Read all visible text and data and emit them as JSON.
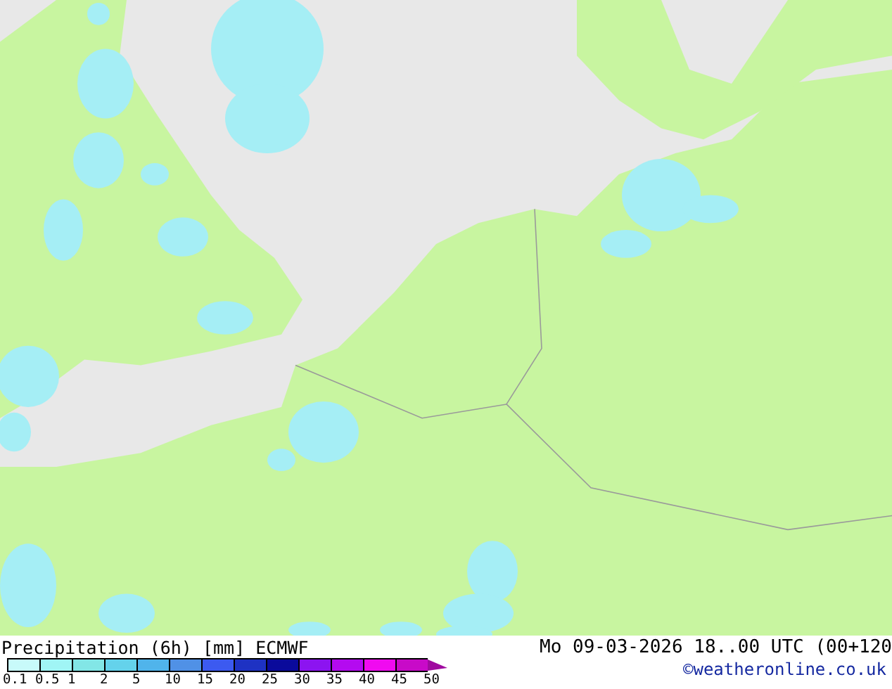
{
  "map": {
    "title": "Precipitation (6h) [mm] ECMWF",
    "valid_time": "Mo 09-03-2026 18..00 UTC (00+120"
  },
  "legend": {
    "swatches": [
      {
        "color": "#c8fafa"
      },
      {
        "color": "#a0f5f5"
      },
      {
        "color": "#82e6e6"
      },
      {
        "color": "#64d2eb"
      },
      {
        "color": "#50b4eb"
      },
      {
        "color": "#5091e6"
      },
      {
        "color": "#3c5af0"
      },
      {
        "color": "#1e32c3"
      },
      {
        "color": "#0a0a9b"
      },
      {
        "color": "#8c14f0"
      },
      {
        "color": "#b40af0"
      },
      {
        "color": "#f00af0"
      },
      {
        "color": "#c80ac8"
      }
    ],
    "labels": [
      "0.1",
      "0.5",
      "1",
      "2",
      "5",
      "10",
      "15",
      "20",
      "25",
      "30",
      "35",
      "40",
      "45",
      "50"
    ]
  },
  "credit": "©weatheronline.co.uk"
}
